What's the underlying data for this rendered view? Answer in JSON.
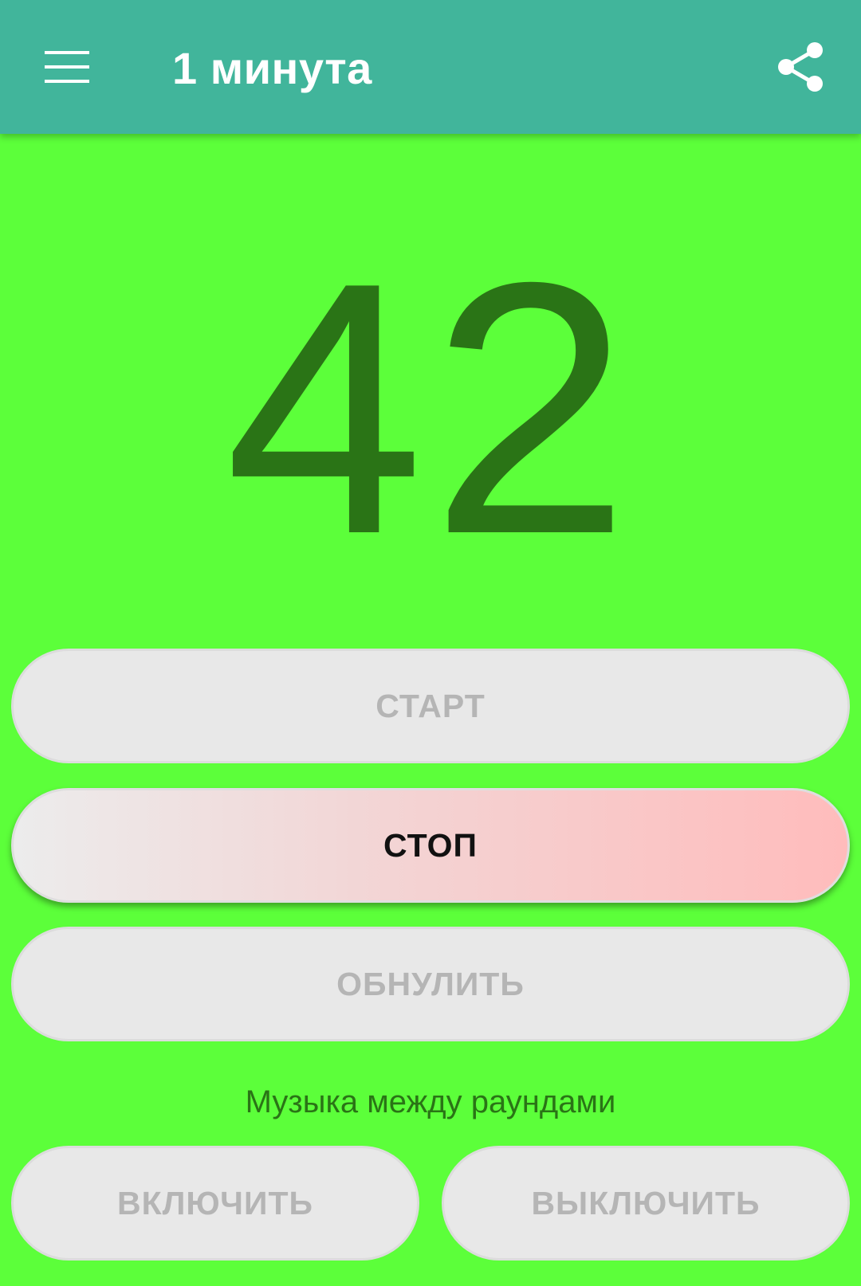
{
  "toolbar": {
    "title": "1 минута",
    "menu_icon": "hamburger-menu-icon",
    "share_icon": "share-icon",
    "background_color": "#41b59b"
  },
  "timer": {
    "value": "42",
    "color": "#2a7416",
    "background_color": "#5cff3a"
  },
  "controls": {
    "start_label": "СТАРТ",
    "stop_label": "СТОП",
    "reset_label": "ОБНУЛИТЬ"
  },
  "music": {
    "label": "Музыка между раундами",
    "on_label": "ВКЛЮЧИТЬ",
    "off_label": "ВЫКЛЮЧИТЬ"
  }
}
